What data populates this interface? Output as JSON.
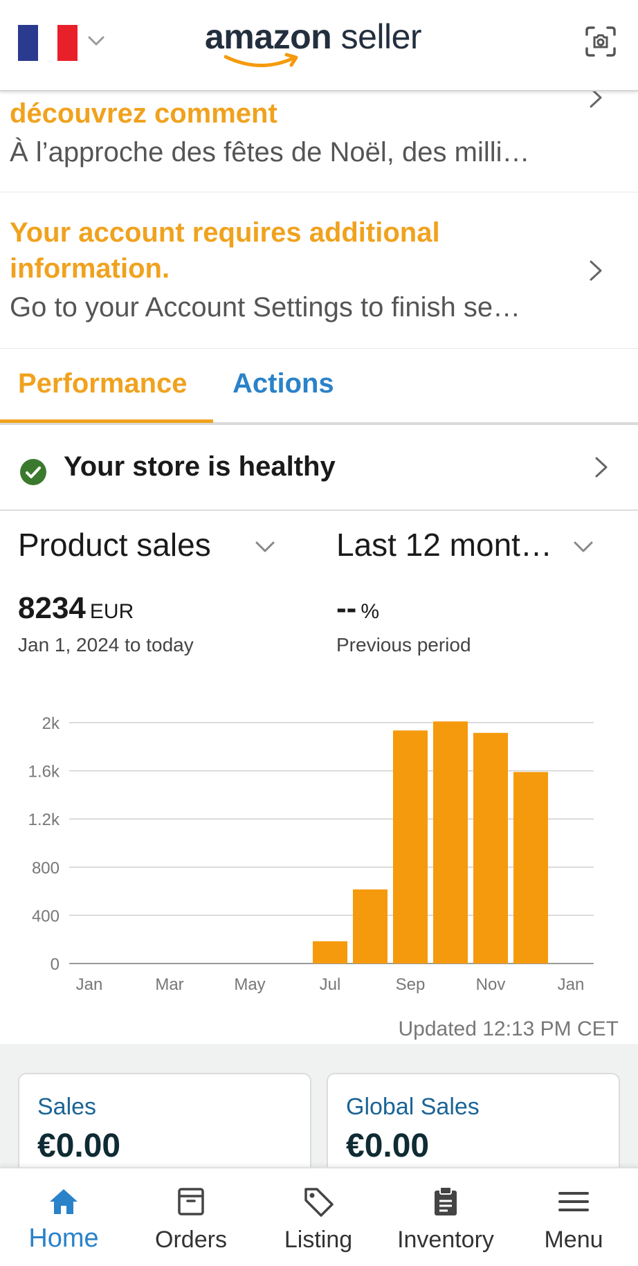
{
  "header": {
    "logo_brand": "amazon",
    "logo_suffix": "seller",
    "flag_colors": [
      "#2a3a8f",
      "#ffffff",
      "#e8202a"
    ],
    "flag_icon": "france-flag-icon",
    "scan_icon": "scan-icon"
  },
  "notifications": [
    {
      "title": "découvrez comment",
      "body": "À l’approche des fêtes de Noël, des milli…"
    },
    {
      "title": "Your account requires additional information.",
      "body": "Go to your Account Settings to finish se…"
    }
  ],
  "tabs": [
    {
      "label": "Performance",
      "active": true
    },
    {
      "label": "Actions",
      "active": false
    }
  ],
  "health": {
    "label": "Your store is healthy",
    "status_color": "#3b7a2e"
  },
  "metric": {
    "selector_label": "Product sales",
    "period_label": "Last 12 mont…",
    "value": "8234",
    "unit": "EUR",
    "range": "Jan 1, 2024 to today",
    "change_value": "--",
    "change_unit": "%",
    "change_caption": "Previous period"
  },
  "chart_data": {
    "type": "bar",
    "categories": [
      "Jan",
      "Feb",
      "Mar",
      "Apr",
      "May",
      "Jun",
      "Jul",
      "Aug",
      "Sep",
      "Oct",
      "Nov",
      "Dec"
    ],
    "values": [
      0,
      0,
      0,
      0,
      0,
      0,
      185,
      615,
      1935,
      2010,
      1915,
      1590
    ],
    "x_tick_labels": [
      "Jan",
      "Mar",
      "May",
      "Jul",
      "Sep",
      "Nov",
      "Jan"
    ],
    "y_tick_labels": [
      "0",
      "400",
      "800",
      "1.2k",
      "1.6k",
      "2k"
    ],
    "y_ticks": [
      0,
      400,
      800,
      1200,
      1600,
      2000
    ],
    "ylim": [
      0,
      2000
    ],
    "grid": true,
    "bar_color": "#f59a0c"
  },
  "updated": "Updated 12:13 PM CET",
  "cards": [
    {
      "label": "Sales",
      "value": "€0.00"
    },
    {
      "label": "Global Sales",
      "value": "€0.00"
    }
  ],
  "nav": [
    {
      "label": "Home",
      "icon": "home-icon",
      "active": true
    },
    {
      "label": "Orders",
      "icon": "orders-box-icon",
      "active": false
    },
    {
      "label": "Listing",
      "icon": "tag-icon",
      "active": false
    },
    {
      "label": "Inventory",
      "icon": "clipboard-icon",
      "active": false
    },
    {
      "label": "Menu",
      "icon": "hamburger-menu-icon",
      "active": false
    }
  ],
  "colors": {
    "accent_orange": "#f0a21e",
    "link_blue": "#2a82c9"
  }
}
